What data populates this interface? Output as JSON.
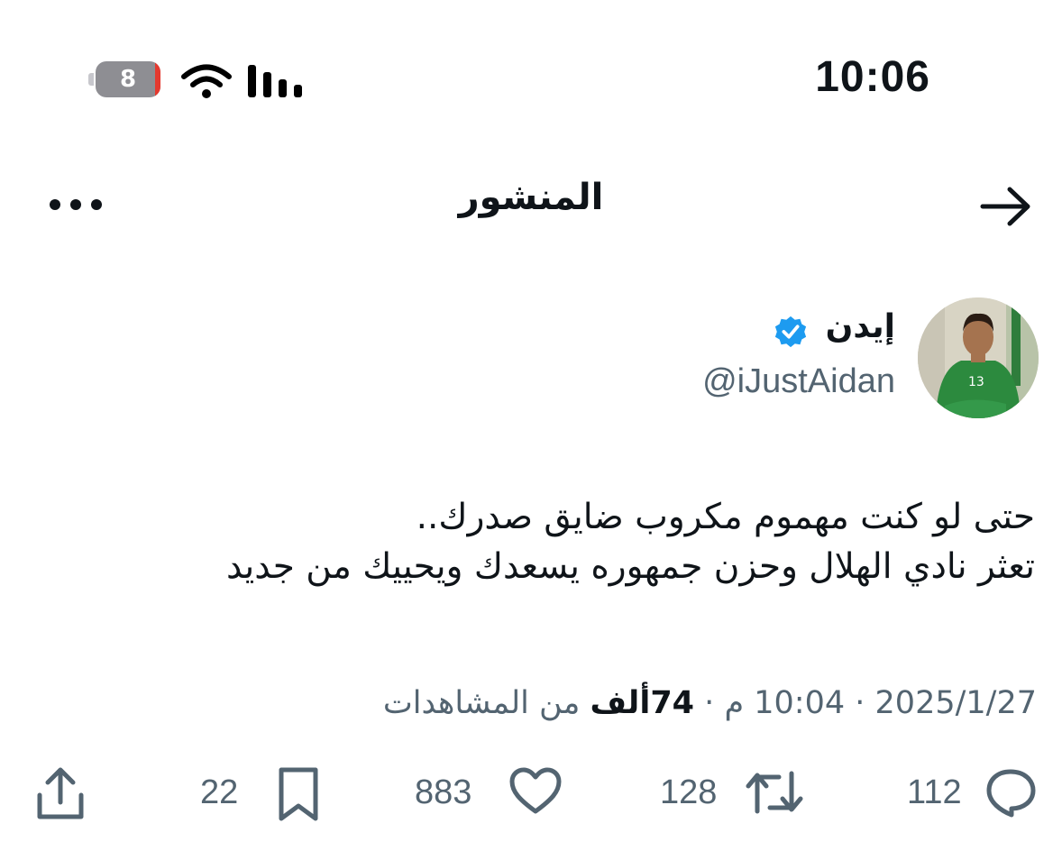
{
  "status_bar": {
    "battery": "8",
    "time": "10:06"
  },
  "header": {
    "title": "المنشور"
  },
  "author": {
    "display_name": "إيدن",
    "handle": "@iJustAidan"
  },
  "post": {
    "text": "حتى لو كنت مهموم مكروب ضايق صدرك..\nتعثر نادي الهلال وحزن جمهوره يسعدك ويحييك من جديد",
    "date": "2025/1/27",
    "time": "10:04 م",
    "views_count": "74ألف",
    "views_label": "من المشاهدات"
  },
  "actions": {
    "replies": "112",
    "reposts": "128",
    "likes": "883",
    "bookmarks": "22"
  },
  "colors": {
    "accent": "#1d9bf0",
    "muted": "#536471",
    "text": "#0f1419"
  }
}
